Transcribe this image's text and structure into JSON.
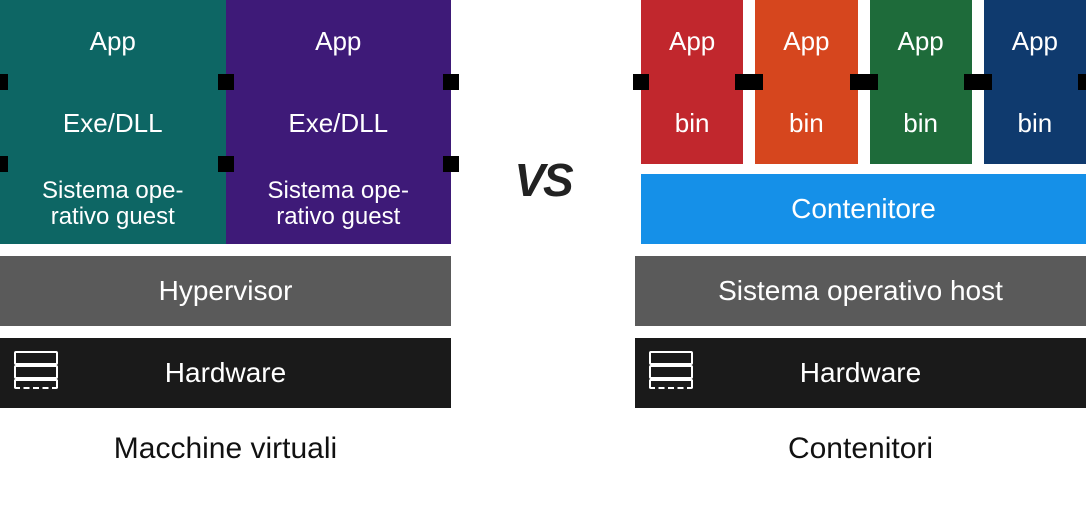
{
  "vs_label": "VS",
  "left": {
    "caption": "Macchine virtuali",
    "hypervisor": "Hypervisor",
    "hardware": "Hardware",
    "vms": [
      {
        "app": "App",
        "exe": "Exe/DLL",
        "os": "Sistema ope-\nrativo guest",
        "color": "teal"
      },
      {
        "app": "App",
        "exe": "Exe/DLL",
        "os": "Sistema ope-\nrativo guest",
        "color": "purple"
      }
    ]
  },
  "right": {
    "caption": "Contenitori",
    "container_engine": "Contenitore",
    "hostos": "Sistema operativo host",
    "hardware": "Hardware",
    "containers": [
      {
        "app": "App",
        "bin": "bin",
        "color": "c-red"
      },
      {
        "app": "App",
        "bin": "bin",
        "color": "c-orange"
      },
      {
        "app": "App",
        "bin": "bin",
        "color": "c-green"
      },
      {
        "app": "App",
        "bin": "bin",
        "color": "c-navy"
      }
    ]
  }
}
